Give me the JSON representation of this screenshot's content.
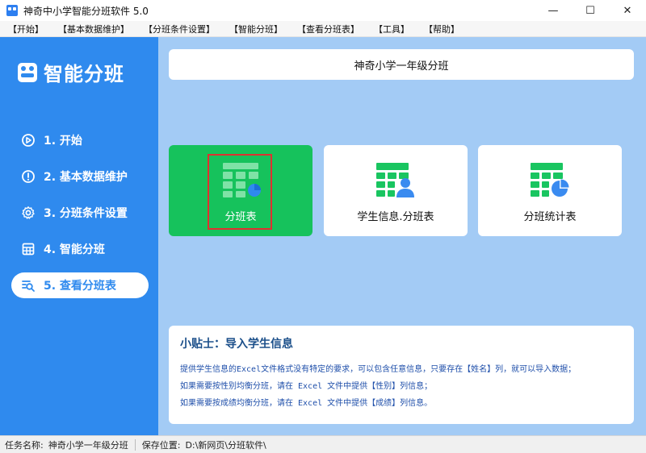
{
  "window": {
    "title": "神奇中小学智能分班软件 5.0",
    "min_symbol": "—",
    "max_symbol": "☐",
    "close_symbol": "✕"
  },
  "menu": [
    "【开始】",
    "【基本数据维护】",
    "【分班条件设置】",
    "【智能分班】",
    "【查看分班表】",
    "【工具】",
    "【帮助】"
  ],
  "sidebar": {
    "brand": "智能分班",
    "items": [
      {
        "label": "1. 开始",
        "icon": "play-circle-icon",
        "active": false
      },
      {
        "label": "2. 基本数据维护",
        "icon": "info-circle-icon",
        "active": false
      },
      {
        "label": "3. 分班条件设置",
        "icon": "gear-icon",
        "active": false
      },
      {
        "label": "4. 智能分班",
        "icon": "calculator-icon",
        "active": false
      },
      {
        "label": "5. 查看分班表",
        "icon": "search-list-icon",
        "active": true
      }
    ]
  },
  "main": {
    "header_title": "神奇小学一年级分班",
    "tiles": [
      {
        "label": "分班表",
        "icon": "grid-table-icon",
        "selected": true
      },
      {
        "label": "学生信息.分班表",
        "icon": "student-table-icon",
        "selected": false
      },
      {
        "label": "分班统计表",
        "icon": "stats-table-icon",
        "selected": false
      }
    ],
    "tip": {
      "title": "小贴士：导入学生信息",
      "lines": [
        "提供学生信息的Excel文件格式没有特定的要求，可以包含任意信息，只要存在【姓名】列，就可以导入数据；",
        "如果需要按性别均衡分班，请在 Excel 文件中提供【性别】列信息；",
        "如果需要按成绩均衡分班，请在 Excel 文件中提供【成绩】列信息。"
      ]
    }
  },
  "status": {
    "task_label": "任务名称:",
    "task_value": "神奇小学一年级分班",
    "path_label": "保存位置:",
    "path_value": "D:\\新网页\\分班软件\\"
  },
  "colors": {
    "sidebar": "#2f8aee",
    "main_bg": "#a3cbf5",
    "tile_active": "#16c25c",
    "icon_green": "#19c560",
    "icon_blue": "#3a8bf0",
    "selection_border": "#e03030"
  }
}
